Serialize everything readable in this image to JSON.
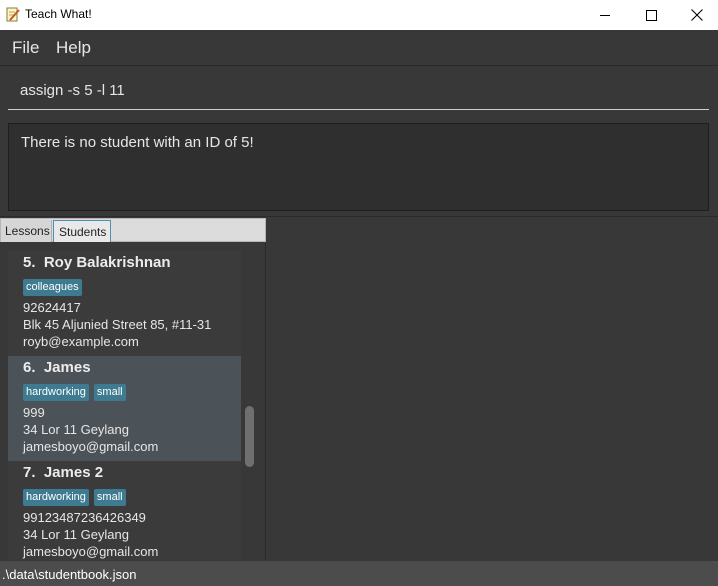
{
  "window": {
    "title": "Teach What!",
    "icon": "notepad-pencil-icon"
  },
  "menu": {
    "file": "File",
    "help": "Help"
  },
  "command": {
    "value": "assign -s 5 -l 11"
  },
  "result": {
    "message": "There is no student with an ID of 5!"
  },
  "tabs": [
    {
      "label": "Lessons",
      "selected": false
    },
    {
      "label": "Students",
      "selected": true
    }
  ],
  "students": [
    {
      "name": "5.  Roy Balakrishnan",
      "tags": [
        "colleagues"
      ],
      "phone": "92624417",
      "address": "Blk 45 Aljunied Street 85, #11-31",
      "email": "royb@example.com",
      "selected": false
    },
    {
      "name": "6.  James",
      "tags": [
        "hardworking",
        "small"
      ],
      "phone": "999",
      "address": "34 Lor 11 Geylang",
      "email": "jamesboyo@gmail.com",
      "selected": true
    },
    {
      "name": "7.  James 2",
      "tags": [
        "hardworking",
        "small"
      ],
      "phone": "99123487236426349",
      "address": "34 Lor 11 Geylang",
      "email": "jamesboyo@gmail.com",
      "selected": false
    }
  ],
  "status": {
    "path": ".\\data\\studentbook.json"
  },
  "colors": {
    "tag": "#3e7b91",
    "selected_card": "#4c5358",
    "background": "#383838"
  }
}
